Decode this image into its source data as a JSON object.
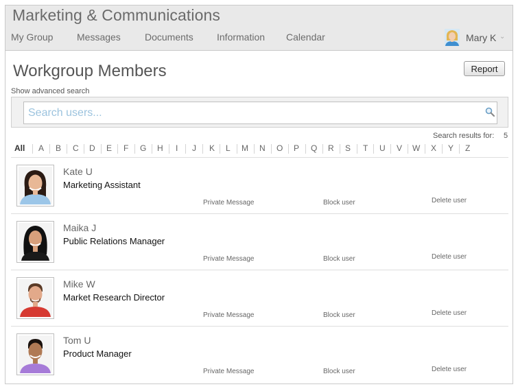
{
  "app": {
    "title": "Marketing & Communications"
  },
  "nav": {
    "items": [
      {
        "label": "My Group"
      },
      {
        "label": "Messages"
      },
      {
        "label": "Documents"
      },
      {
        "label": "Information"
      },
      {
        "label": "Calendar"
      }
    ]
  },
  "user": {
    "name": "Mary K",
    "caret": "⌄"
  },
  "page": {
    "title": "Workgroup Members",
    "report_label": "Report",
    "advanced_search_label": "Show advanced search"
  },
  "search": {
    "placeholder": "Search users...",
    "value": ""
  },
  "results": {
    "label": "Search results for:",
    "count": "5"
  },
  "alphabet": [
    "All",
    "A",
    "B",
    "C",
    "D",
    "E",
    "F",
    "G",
    "H",
    "I",
    "J",
    "K",
    "L",
    "M",
    "N",
    "O",
    "P",
    "Q",
    "R",
    "S",
    "T",
    "U",
    "V",
    "W",
    "X",
    "Y",
    "Z"
  ],
  "actions": {
    "private_message": "Private Message",
    "block_user": "Block user",
    "delete_user": "Delete user"
  },
  "members": [
    {
      "name": "Kate U",
      "role": "Marketing Assistant",
      "avatar": "female-avatar-icon"
    },
    {
      "name": "Maika J",
      "role": "Public Relations Manager",
      "avatar": "female-avatar-icon"
    },
    {
      "name": "Mike W",
      "role": "Market Research Director",
      "avatar": "male-avatar-icon"
    },
    {
      "name": "Tom U",
      "role": "Product Manager",
      "avatar": "male-avatar-icon"
    }
  ],
  "colors": {
    "header_bg": "#e9e9e9",
    "placeholder": "#9cc3de",
    "search_icon": "#6a9fc6"
  }
}
